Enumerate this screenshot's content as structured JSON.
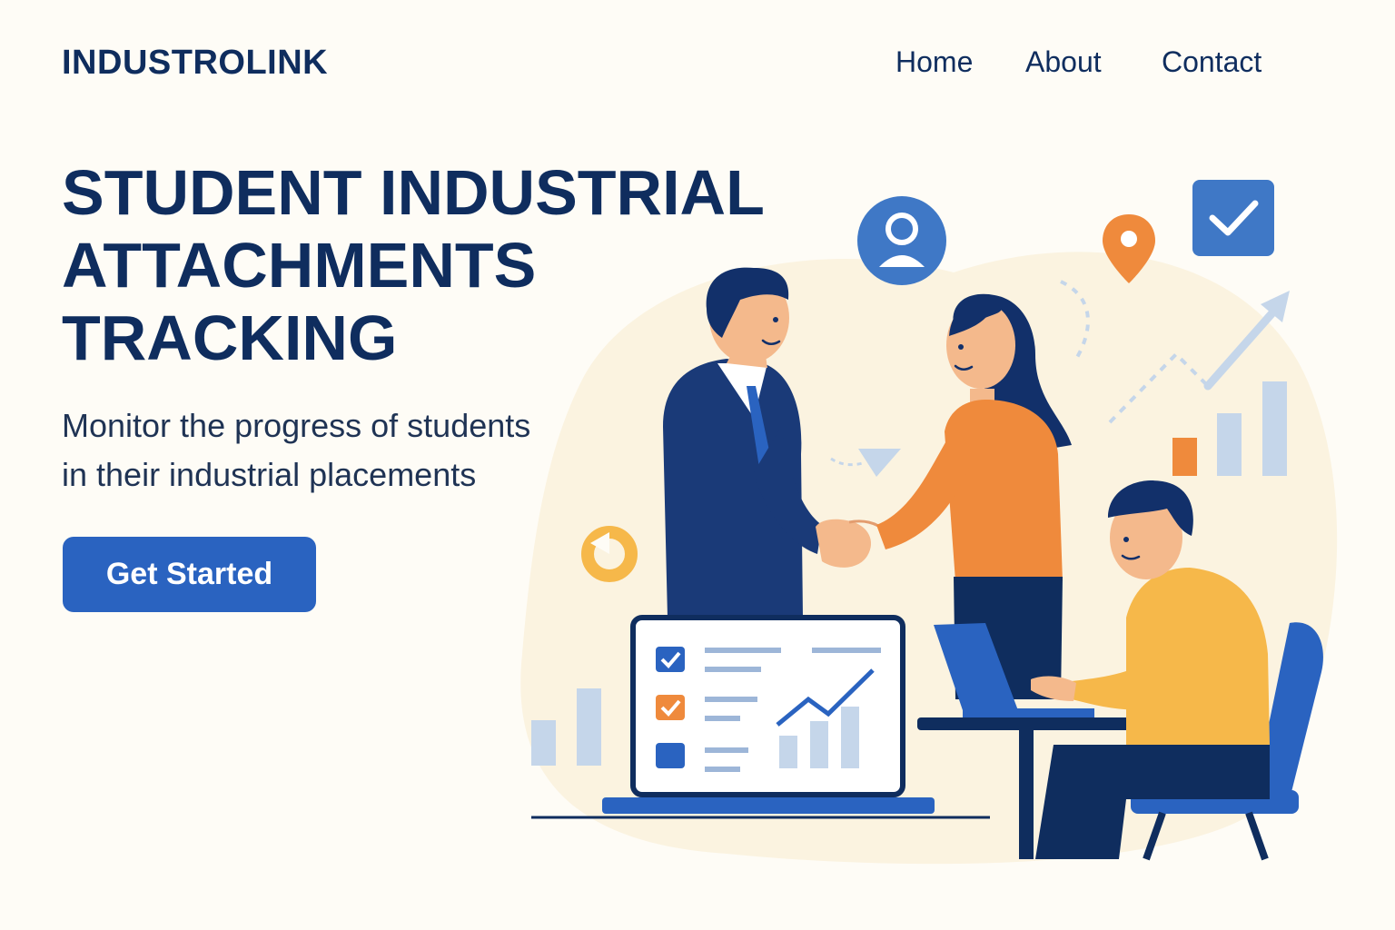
{
  "header": {
    "brand": "INDUSTROLINK",
    "nav": [
      {
        "label": "Home"
      },
      {
        "label": "About"
      },
      {
        "label": "Contact"
      }
    ]
  },
  "hero": {
    "title_lines": [
      "STUDENT INDUSTRIAL",
      "ATTACHMENTS",
      "TRACKING"
    ],
    "subtitle_lines": [
      "Monitor the progress of students",
      "in their industrial placements"
    ],
    "cta_label": "Get Started"
  },
  "illustration": {
    "scene": "handshake-team-illustration",
    "icons": [
      "user-icon",
      "location-pin-icon",
      "checkbox-icon",
      "donut-icon",
      "trend-arrow-icon"
    ],
    "colors": {
      "navy": "#0f2d5e",
      "blue": "#2a63c0",
      "light_blue": "#c5d6ea",
      "orange": "#ef8a3c",
      "yellow": "#f6b84a",
      "skin": "#f4b98c",
      "background": "#fefcf6"
    }
  }
}
